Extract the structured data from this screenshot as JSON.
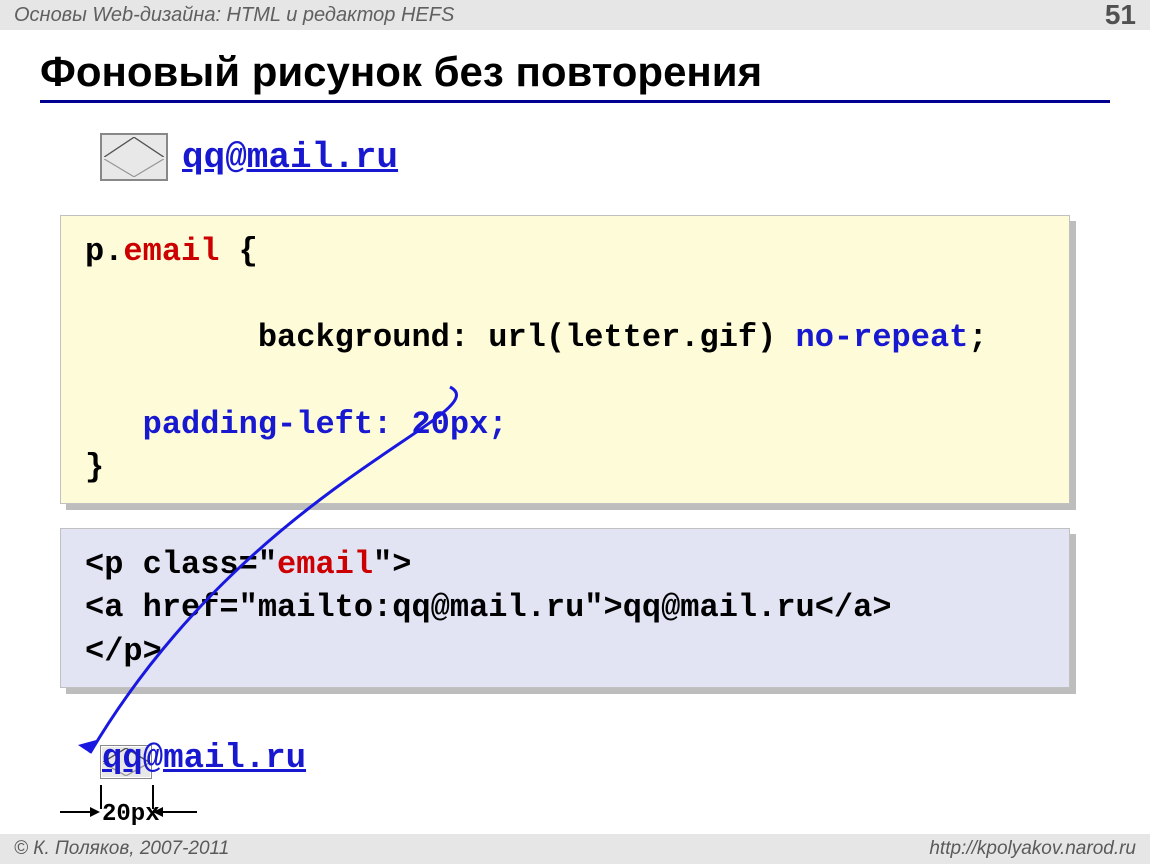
{
  "header": {
    "breadcrumb": "Основы Web-дизайна: HTML и редактор HEFS",
    "slide_number": "51"
  },
  "title": "Фоновый рисунок без повторения",
  "email_example": {
    "text": "qq@mail.ru"
  },
  "css_block": {
    "selector_prefix": "p.",
    "selector_class": "email",
    "open_brace": " {",
    "line2_prefix": "   background: url(letter.gif) ",
    "line2_value": "no-repeat",
    "line2_suffix": ";",
    "line3": "   padding-left: 20px;",
    "close_brace": "}"
  },
  "html_block": {
    "line1_prefix": "<p class=\"",
    "line1_class": "email",
    "line1_suffix": "\">",
    "line2": "<a href=\"mailto:qq@mail.ru\">qq@mail.ru</a>",
    "line3": "</p>"
  },
  "result": {
    "text": "qq@mail.ru"
  },
  "measure": {
    "label": "20px"
  },
  "footer": {
    "copyright": "© К. Поляков, 2007-2011",
    "url": "http://kpolyakov.narod.ru"
  }
}
